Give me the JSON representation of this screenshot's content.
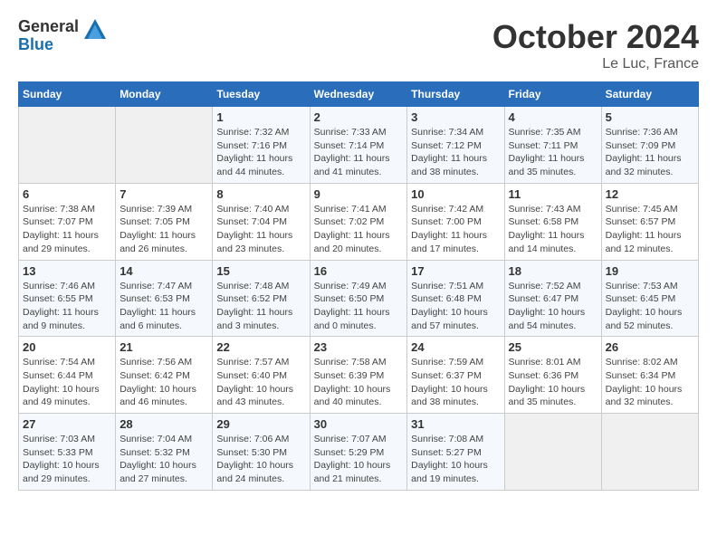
{
  "header": {
    "logo_general": "General",
    "logo_blue": "Blue",
    "month_title": "October 2024",
    "location": "Le Luc, France"
  },
  "days_of_week": [
    "Sunday",
    "Monday",
    "Tuesday",
    "Wednesday",
    "Thursday",
    "Friday",
    "Saturday"
  ],
  "weeks": [
    [
      {
        "day": "",
        "sunrise": "",
        "sunset": "",
        "daylight": ""
      },
      {
        "day": "",
        "sunrise": "",
        "sunset": "",
        "daylight": ""
      },
      {
        "day": "1",
        "sunrise": "Sunrise: 7:32 AM",
        "sunset": "Sunset: 7:16 PM",
        "daylight": "Daylight: 11 hours and 44 minutes."
      },
      {
        "day": "2",
        "sunrise": "Sunrise: 7:33 AM",
        "sunset": "Sunset: 7:14 PM",
        "daylight": "Daylight: 11 hours and 41 minutes."
      },
      {
        "day": "3",
        "sunrise": "Sunrise: 7:34 AM",
        "sunset": "Sunset: 7:12 PM",
        "daylight": "Daylight: 11 hours and 38 minutes."
      },
      {
        "day": "4",
        "sunrise": "Sunrise: 7:35 AM",
        "sunset": "Sunset: 7:11 PM",
        "daylight": "Daylight: 11 hours and 35 minutes."
      },
      {
        "day": "5",
        "sunrise": "Sunrise: 7:36 AM",
        "sunset": "Sunset: 7:09 PM",
        "daylight": "Daylight: 11 hours and 32 minutes."
      }
    ],
    [
      {
        "day": "6",
        "sunrise": "Sunrise: 7:38 AM",
        "sunset": "Sunset: 7:07 PM",
        "daylight": "Daylight: 11 hours and 29 minutes."
      },
      {
        "day": "7",
        "sunrise": "Sunrise: 7:39 AM",
        "sunset": "Sunset: 7:05 PM",
        "daylight": "Daylight: 11 hours and 26 minutes."
      },
      {
        "day": "8",
        "sunrise": "Sunrise: 7:40 AM",
        "sunset": "Sunset: 7:04 PM",
        "daylight": "Daylight: 11 hours and 23 minutes."
      },
      {
        "day": "9",
        "sunrise": "Sunrise: 7:41 AM",
        "sunset": "Sunset: 7:02 PM",
        "daylight": "Daylight: 11 hours and 20 minutes."
      },
      {
        "day": "10",
        "sunrise": "Sunrise: 7:42 AM",
        "sunset": "Sunset: 7:00 PM",
        "daylight": "Daylight: 11 hours and 17 minutes."
      },
      {
        "day": "11",
        "sunrise": "Sunrise: 7:43 AM",
        "sunset": "Sunset: 6:58 PM",
        "daylight": "Daylight: 11 hours and 14 minutes."
      },
      {
        "day": "12",
        "sunrise": "Sunrise: 7:45 AM",
        "sunset": "Sunset: 6:57 PM",
        "daylight": "Daylight: 11 hours and 12 minutes."
      }
    ],
    [
      {
        "day": "13",
        "sunrise": "Sunrise: 7:46 AM",
        "sunset": "Sunset: 6:55 PM",
        "daylight": "Daylight: 11 hours and 9 minutes."
      },
      {
        "day": "14",
        "sunrise": "Sunrise: 7:47 AM",
        "sunset": "Sunset: 6:53 PM",
        "daylight": "Daylight: 11 hours and 6 minutes."
      },
      {
        "day": "15",
        "sunrise": "Sunrise: 7:48 AM",
        "sunset": "Sunset: 6:52 PM",
        "daylight": "Daylight: 11 hours and 3 minutes."
      },
      {
        "day": "16",
        "sunrise": "Sunrise: 7:49 AM",
        "sunset": "Sunset: 6:50 PM",
        "daylight": "Daylight: 11 hours and 0 minutes."
      },
      {
        "day": "17",
        "sunrise": "Sunrise: 7:51 AM",
        "sunset": "Sunset: 6:48 PM",
        "daylight": "Daylight: 10 hours and 57 minutes."
      },
      {
        "day": "18",
        "sunrise": "Sunrise: 7:52 AM",
        "sunset": "Sunset: 6:47 PM",
        "daylight": "Daylight: 10 hours and 54 minutes."
      },
      {
        "day": "19",
        "sunrise": "Sunrise: 7:53 AM",
        "sunset": "Sunset: 6:45 PM",
        "daylight": "Daylight: 10 hours and 52 minutes."
      }
    ],
    [
      {
        "day": "20",
        "sunrise": "Sunrise: 7:54 AM",
        "sunset": "Sunset: 6:44 PM",
        "daylight": "Daylight: 10 hours and 49 minutes."
      },
      {
        "day": "21",
        "sunrise": "Sunrise: 7:56 AM",
        "sunset": "Sunset: 6:42 PM",
        "daylight": "Daylight: 10 hours and 46 minutes."
      },
      {
        "day": "22",
        "sunrise": "Sunrise: 7:57 AM",
        "sunset": "Sunset: 6:40 PM",
        "daylight": "Daylight: 10 hours and 43 minutes."
      },
      {
        "day": "23",
        "sunrise": "Sunrise: 7:58 AM",
        "sunset": "Sunset: 6:39 PM",
        "daylight": "Daylight: 10 hours and 40 minutes."
      },
      {
        "day": "24",
        "sunrise": "Sunrise: 7:59 AM",
        "sunset": "Sunset: 6:37 PM",
        "daylight": "Daylight: 10 hours and 38 minutes."
      },
      {
        "day": "25",
        "sunrise": "Sunrise: 8:01 AM",
        "sunset": "Sunset: 6:36 PM",
        "daylight": "Daylight: 10 hours and 35 minutes."
      },
      {
        "day": "26",
        "sunrise": "Sunrise: 8:02 AM",
        "sunset": "Sunset: 6:34 PM",
        "daylight": "Daylight: 10 hours and 32 minutes."
      }
    ],
    [
      {
        "day": "27",
        "sunrise": "Sunrise: 7:03 AM",
        "sunset": "Sunset: 5:33 PM",
        "daylight": "Daylight: 10 hours and 29 minutes."
      },
      {
        "day": "28",
        "sunrise": "Sunrise: 7:04 AM",
        "sunset": "Sunset: 5:32 PM",
        "daylight": "Daylight: 10 hours and 27 minutes."
      },
      {
        "day": "29",
        "sunrise": "Sunrise: 7:06 AM",
        "sunset": "Sunset: 5:30 PM",
        "daylight": "Daylight: 10 hours and 24 minutes."
      },
      {
        "day": "30",
        "sunrise": "Sunrise: 7:07 AM",
        "sunset": "Sunset: 5:29 PM",
        "daylight": "Daylight: 10 hours and 21 minutes."
      },
      {
        "day": "31",
        "sunrise": "Sunrise: 7:08 AM",
        "sunset": "Sunset: 5:27 PM",
        "daylight": "Daylight: 10 hours and 19 minutes."
      },
      {
        "day": "",
        "sunrise": "",
        "sunset": "",
        "daylight": ""
      },
      {
        "day": "",
        "sunrise": "",
        "sunset": "",
        "daylight": ""
      }
    ]
  ]
}
